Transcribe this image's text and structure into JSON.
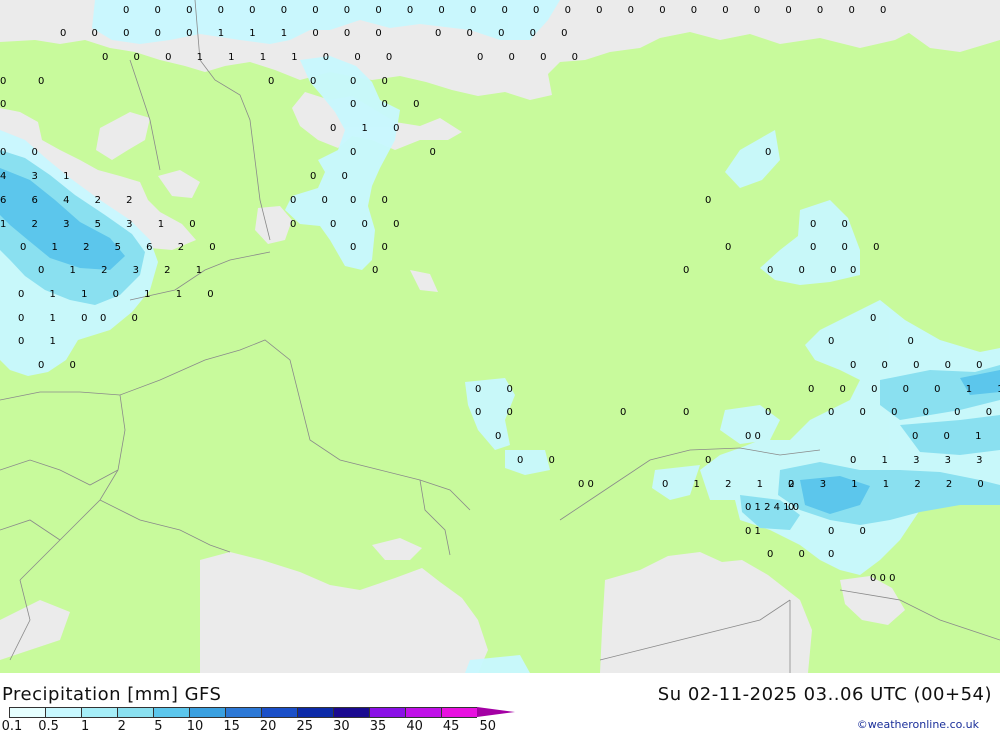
{
  "header": {
    "title": "Precipitation [mm] GFS",
    "datetime": "Su 02-11-2025 03..06 UTC (00+54)"
  },
  "legend": {
    "ticks": [
      "0.1",
      "0.5",
      "1",
      "2",
      "5",
      "10",
      "15",
      "20",
      "25",
      "30",
      "35",
      "40",
      "45",
      "50"
    ],
    "colors": [
      "#e6ffff",
      "#c8f8ff",
      "#a6eef8",
      "#8ae0f0",
      "#5cc6ec",
      "#3aa0e0",
      "#2c78d6",
      "#1a4fc8",
      "#0c2aa8",
      "#1a0a90",
      "#8a10e6",
      "#c010e8",
      "#e810e0",
      "#d010c0"
    ]
  },
  "credit": "©weatheronline.co.uk",
  "colors": {
    "land": "#c8fa9c",
    "sea": "#ebebeb",
    "precip_light": "#c8f8ff",
    "precip_medium": "#8ae0f0",
    "precip_heavy": "#5cc6ec"
  },
  "map_values": [
    "0 0 0 0 0 0 0 0 0 0 0 0 0 0 0 0 0 0 0 0 0 0 0 0 0",
    "0 0 0 0 0 1 1 1 0 0 0",
    "0 0 0 0 0",
    "0 0 0 1 1 1 1 0 0 0",
    "0 0 0 0",
    "0",
    "0",
    "0",
    "0",
    "0 0",
    "0 0 0",
    "0",
    "0 1 0",
    "0 0",
    "0 0",
    "0",
    "4 3 1",
    "0 0",
    "6 6 4 2 2",
    "0 0",
    "0 0",
    "0",
    "1 2 3 5 3 1 0",
    "0",
    "0 0 0",
    "0 0",
    "0 1 2 5 6 2 0",
    "0 0",
    "0",
    "0 0 0",
    "0 1 2 3 2 1",
    "0",
    "0",
    "0 0 0",
    "0",
    "0 1 1 0 1 1 0",
    "0 1 0",
    "0 0",
    "0",
    "0 1",
    "0 0",
    "0 0",
    "0 0 0 0 0 1 1 1 1",
    "0 0",
    "0 0 0 0 0 1 1 2 2 2",
    "0 0",
    "0",
    "0",
    "0",
    "0 0 0 0 0 0 0 1 1",
    "0",
    "0 0 1 2 3",
    "0 0",
    "0 0",
    "0 1 3 3 3 2 3 1",
    "0",
    "0 0",
    "0 1 2 1 2 3 1 1 2 2 0",
    "0",
    "0 1 2 4 1 0",
    "0",
    "0 1",
    "0 0",
    "0 0",
    "0",
    "0 0 0"
  ]
}
